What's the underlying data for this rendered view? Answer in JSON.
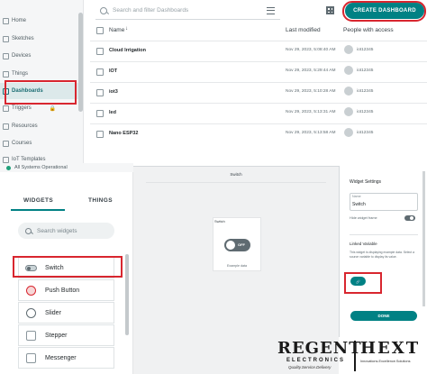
{
  "sidebar": {
    "items": [
      {
        "label": "Home",
        "icon": "home-icon"
      },
      {
        "label": "Sketches",
        "icon": "sketch-icon"
      },
      {
        "label": "Devices",
        "icon": "device-icon"
      },
      {
        "label": "Things",
        "icon": "things-icon"
      },
      {
        "label": "Dashboards",
        "icon": "dashboard-icon",
        "active": true
      },
      {
        "label": "Triggers",
        "icon": "trigger-icon"
      },
      {
        "label": "Resources",
        "icon": "resources-icon"
      },
      {
        "label": "Courses",
        "icon": "courses-icon"
      },
      {
        "label": "IoT Templates",
        "icon": "templates-icon"
      }
    ],
    "status": "All Systems Operational"
  },
  "dashboards": {
    "search_placeholder": "Search and filter Dashboards",
    "create_button": "CREATE DASHBOARD",
    "columns": [
      "Name",
      "Last modified",
      "People with access"
    ],
    "rows": [
      {
        "name": "Cloud Irrigation",
        "modified": "Nov 29, 2023, 5:08:40 AM",
        "owner": "iot12345"
      },
      {
        "name": "IOT",
        "modified": "Nov 29, 2023, 5:29:44 AM",
        "owner": "iot12345"
      },
      {
        "name": "iot3",
        "modified": "Nov 29, 2023, 5:10:28 AM",
        "owner": "iot12345"
      },
      {
        "name": "led",
        "modified": "Nov 29, 2023, 5:13:31 AM",
        "owner": "iot12345"
      },
      {
        "name": "Nano ESP32",
        "modified": "Nov 29, 2023, 5:13:58 AM",
        "owner": "iot12345"
      }
    ]
  },
  "widgets_panel": {
    "tabs": [
      "WIDGETS",
      "THINGS"
    ],
    "search_placeholder": "Search widgets",
    "items": [
      {
        "label": "Switch",
        "icon": "switch-icon"
      },
      {
        "label": "Push Button",
        "icon": "push-button-icon"
      },
      {
        "label": "Slider",
        "icon": "slider-icon"
      },
      {
        "label": "Stepper",
        "icon": "stepper-icon"
      },
      {
        "label": "Messenger",
        "icon": "messenger-icon"
      }
    ]
  },
  "canvas": {
    "title": "Switch",
    "card_title": "Switch",
    "toggle_text": "OFF",
    "caption": "Example data"
  },
  "settings": {
    "title": "Widget Settings",
    "name_label": "Name",
    "name_value": "Switch",
    "hide_label": "Hide widget frame",
    "linked_title": "Linked Variable",
    "linked_info": "This widget is displaying example data. Select a source variable to display its value.",
    "link_button": "ㅤ",
    "done_button": "DONE"
  },
  "logo": {
    "brand": "REGENT",
    "sub": "ELECTRONICS",
    "tagline": "Quality.Service.Delivery",
    "partner": "HEXT",
    "partner_tagline": "Innovations.Excellence.Solutions"
  },
  "colors": {
    "accent": "#008184",
    "highlight": "#d8262f",
    "status_ok": "#20a07a"
  }
}
